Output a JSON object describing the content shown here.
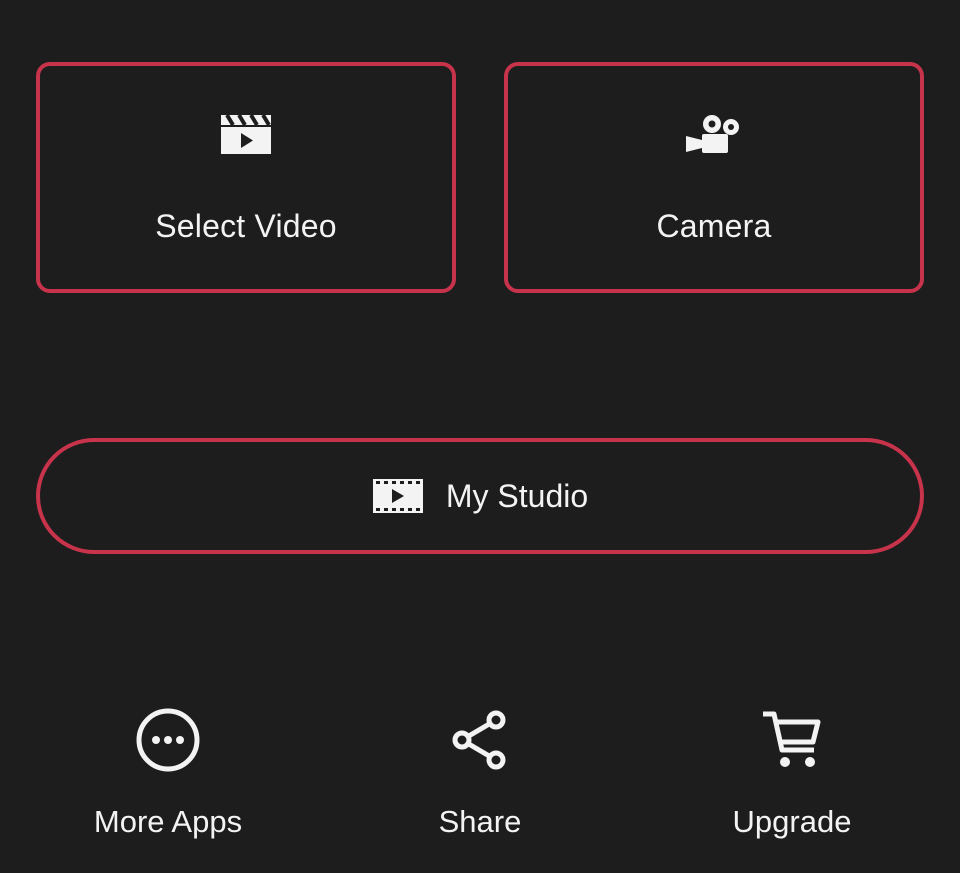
{
  "actions": {
    "select_video_label": "Select Video",
    "camera_label": "Camera",
    "my_studio_label": "My Studio"
  },
  "bottom_bar": {
    "more_apps_label": "More Apps",
    "share_label": "Share",
    "upgrade_label": "Upgrade"
  },
  "icons": {
    "select_video": "clapperboard-icon",
    "camera": "video-camera-icon",
    "my_studio": "film-strip-icon",
    "more_apps": "more-dots-icon",
    "share": "share-icon",
    "upgrade": "cart-icon"
  },
  "colors": {
    "background": "#1d1d1e",
    "accent_border": "#c7334b",
    "text": "#f3f3f3"
  }
}
